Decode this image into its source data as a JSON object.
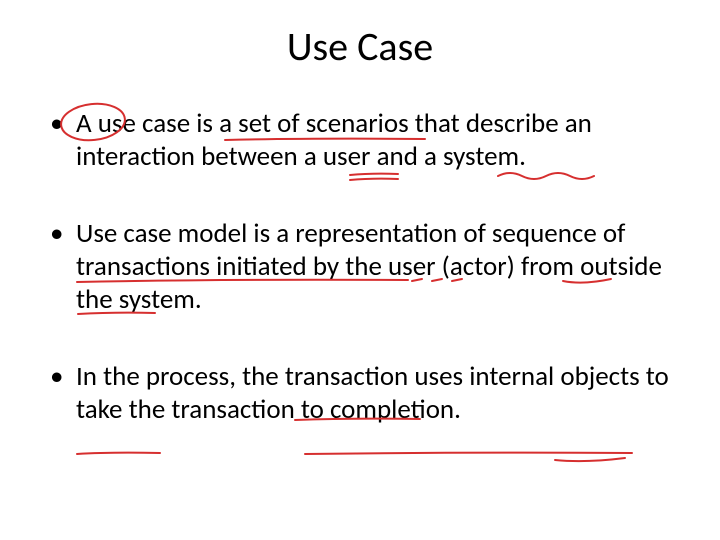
{
  "title": "Use Case",
  "bullets": [
    "A use case is a set of scenarios that describe an  interaction between a user and a system.",
    "Use case model is a representation of sequence of transactions initiated by the user (actor) from outside the system.",
    "In the process, the transaction uses internal objects to take the transaction to completion."
  ]
}
